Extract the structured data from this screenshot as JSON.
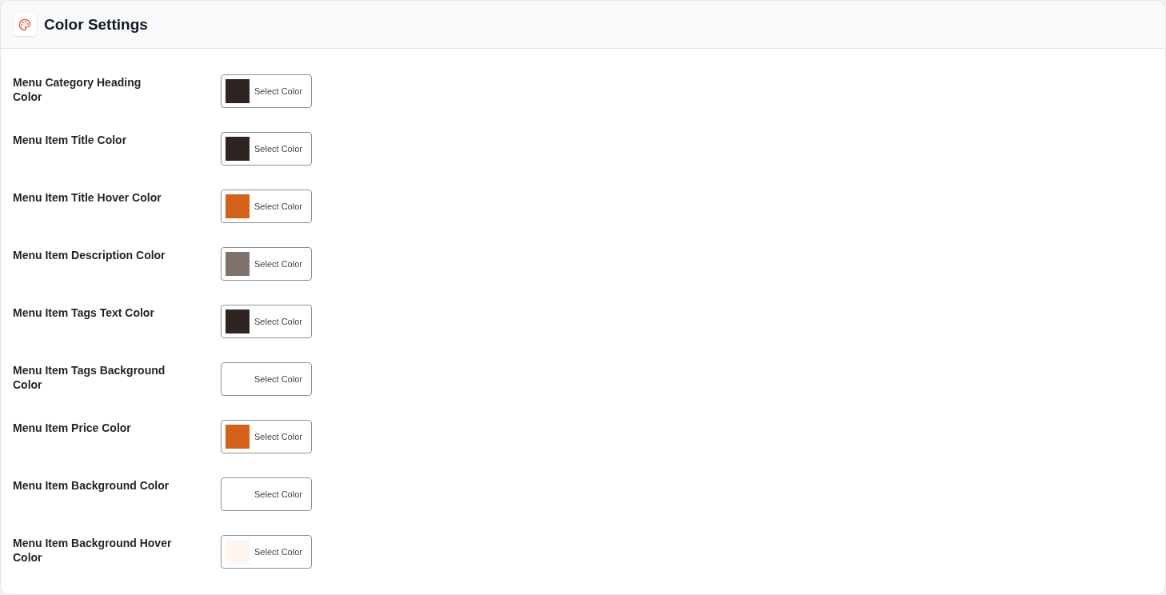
{
  "header": {
    "title": "Color Settings"
  },
  "settings": [
    {
      "label": "Menu Category Heading Color",
      "color": "#2e2523",
      "button": "Select Color"
    },
    {
      "label": "Menu Item Title Color",
      "color": "#2e2523",
      "button": "Select Color"
    },
    {
      "label": "Menu Item Title Hover Color",
      "color": "#d5621a",
      "button": "Select Color"
    },
    {
      "label": "Menu Item Description Color",
      "color": "#7f726b",
      "button": "Select Color"
    },
    {
      "label": "Menu Item Tags Text Color",
      "color": "#2e2523",
      "button": "Select Color"
    },
    {
      "label": "Menu Item Tags Background Color",
      "button": "Select Color"
    },
    {
      "label": "Menu Item Price Color",
      "color": "#d5621a",
      "button": "Select Color"
    },
    {
      "label": "Menu Item Background Color",
      "button": "Select Color"
    },
    {
      "label": "Menu Item Background Hover Color",
      "color": "#fff6f2",
      "button": "Select Color"
    }
  ]
}
